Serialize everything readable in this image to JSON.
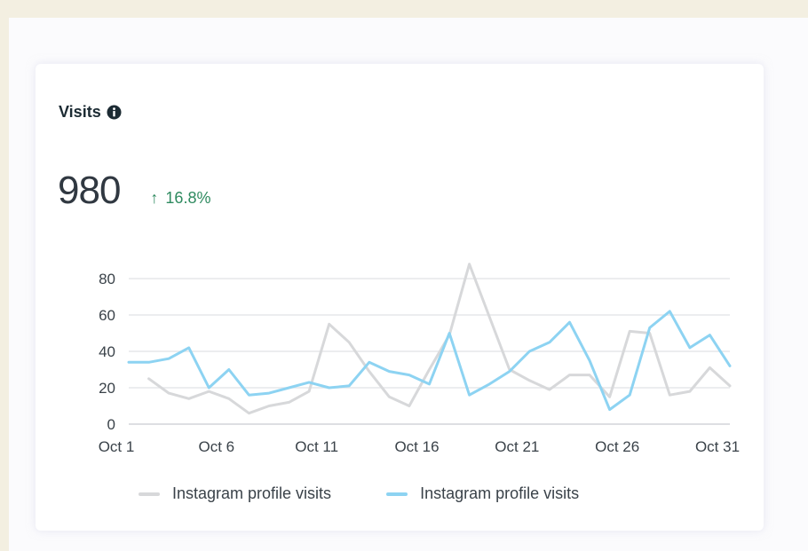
{
  "card": {
    "title": "Visits",
    "info_icon": "info-circle-icon",
    "value": "980",
    "trend_icon": "arrow-up-icon",
    "trend_glyph": "↑",
    "trend_text": "16.8%",
    "trend_color": "#2e8a5f"
  },
  "chart_data": {
    "type": "line",
    "x": [
      1,
      2,
      3,
      4,
      5,
      6,
      7,
      8,
      9,
      10,
      11,
      12,
      13,
      14,
      15,
      16,
      17,
      18,
      19,
      20,
      21,
      22,
      23,
      24,
      25,
      26,
      27,
      28,
      29,
      30,
      31
    ],
    "x_tick_labels": [
      "Oct 1",
      "Oct 6",
      "Oct 11",
      "Oct 16",
      "Oct 21",
      "Oct 26",
      "Oct 31"
    ],
    "x_tick_values": [
      1,
      6,
      11,
      16,
      21,
      26,
      31
    ],
    "y_ticks": [
      0,
      20,
      40,
      60,
      80
    ],
    "ylim": [
      0,
      80
    ],
    "grid": true,
    "legend_position": "bottom",
    "series": [
      {
        "name": "Instagram profile visits",
        "color": "#d7d8da",
        "values": [
          null,
          25,
          17,
          14,
          18,
          14,
          6,
          10,
          12,
          18,
          55,
          45,
          29,
          15,
          10,
          30,
          49,
          88,
          59,
          30,
          24,
          19,
          27,
          27,
          15,
          51,
          50,
          16,
          18,
          31,
          21
        ]
      },
      {
        "name": "Instagram profile visits",
        "color": "#8dd3f2",
        "values": [
          34,
          34,
          36,
          42,
          20,
          30,
          16,
          17,
          20,
          23,
          20,
          21,
          34,
          29,
          27,
          22,
          50,
          16,
          22,
          29,
          40,
          45,
          56,
          35,
          8,
          16,
          53,
          62,
          42,
          49,
          32
        ]
      }
    ]
  }
}
